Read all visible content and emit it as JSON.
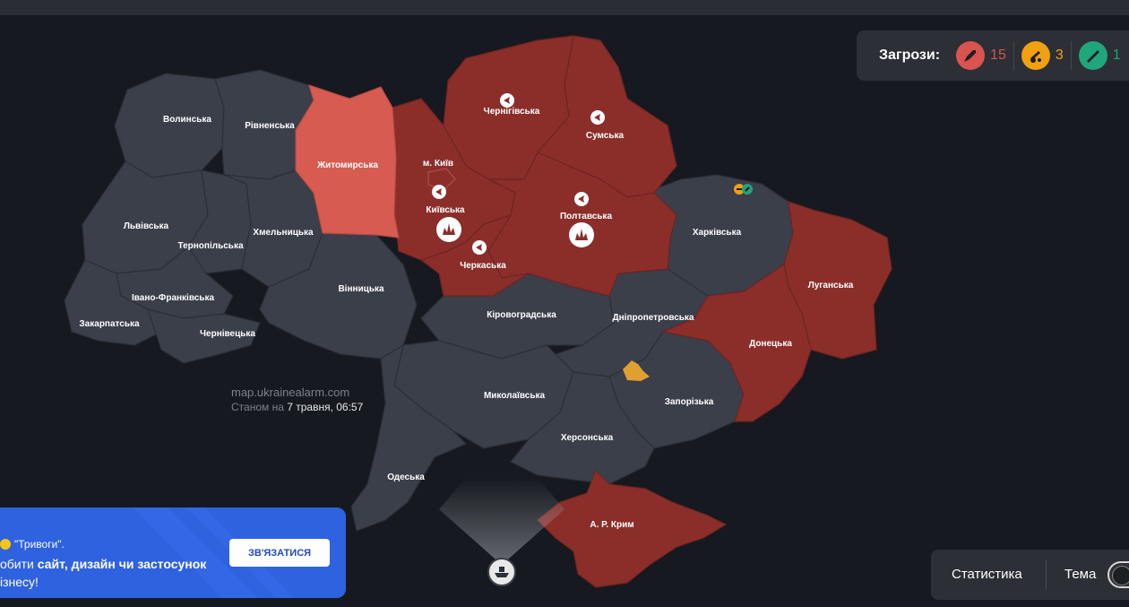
{
  "threats": {
    "title": "Загрози:",
    "items": [
      {
        "icon": "missile-icon",
        "count": "15",
        "color": "#d9534f"
      },
      {
        "icon": "artillery-icon",
        "count": "3",
        "color": "#f0a010"
      },
      {
        "icon": "rifle-icon",
        "count": "1",
        "color": "#1fa67a"
      }
    ]
  },
  "regions": {
    "volynska": "Волинська",
    "rivnenska": "Рівненська",
    "zhytomyrska": "Житомирська",
    "kyiv_city": "м. Київ",
    "kyivska": "Київська",
    "chernihivska": "Чернігівська",
    "sumska": "Сумська",
    "poltavska": "Полтавська",
    "cherkaska": "Черкаська",
    "kharkivska": "Харківська",
    "luhanska": "Луганська",
    "donetska": "Донецька",
    "zaporizka": "Запорізька",
    "dnipropetrovska": "Дніпропетровська",
    "kirovohradska": "Кіровоградська",
    "vinnytska": "Вінницька",
    "khmelnytska": "Хмельницька",
    "lvivska": "Львівська",
    "ternopilska": "Тернопільська",
    "ivano_frankivska": "Івано-Франківська",
    "zakarpatska": "Закарпатська",
    "chernivetska": "Чернівецька",
    "mykolaivska": "Миколаївська",
    "khersonska": "Херсонська",
    "odeska": "Одеська",
    "crimea": "А. Р. Крим"
  },
  "alert_status": {
    "active": [
      "chernihivska",
      "sumska",
      "kyivska",
      "kyiv_city",
      "poltavska",
      "cherkaska",
      "luhanska",
      "donetska",
      "crimea"
    ],
    "partial": [
      "zhytomyrska"
    ],
    "colors": {
      "active": "#8b2e2a",
      "partial": "#d75b50",
      "calm": "#3a3f4a"
    }
  },
  "watermark": {
    "url": "map.ukrainealarm.com",
    "date_prefix": "Станом на",
    "date_value": "7 травня, 06:57"
  },
  "promo": {
    "line1": "\"Тривоги\".",
    "line2_prefix": "обити ",
    "line2_bold": "сайт, дизайн чи застосунок",
    "line3": "ізнесу!",
    "button": "ЗВ'ЯЗАТИСЯ"
  },
  "bottom": {
    "stats": "Статистика",
    "theme": "Тема"
  }
}
